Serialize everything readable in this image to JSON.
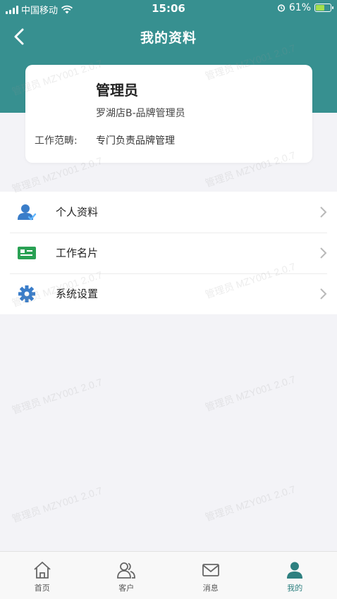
{
  "status_bar": {
    "carrier": "中国移动",
    "time": "15:06",
    "battery_text": "61%",
    "battery_level": 0.61
  },
  "nav": {
    "title": "我的资料"
  },
  "profile": {
    "name": "管理员",
    "role": "罗湖店B-品牌管理员",
    "scope_label": "工作范畴:",
    "scope_value": "专门负责品牌管理"
  },
  "menu": {
    "items": [
      {
        "label": "个人资料",
        "icon": "person-icon"
      },
      {
        "label": "工作名片",
        "icon": "business-card-icon"
      },
      {
        "label": "系统设置",
        "icon": "gear-icon"
      }
    ]
  },
  "watermark": {
    "text": "管理员 MZY001 2.0.7"
  },
  "tabs": [
    {
      "label": "首页",
      "icon": "home-icon",
      "active": false
    },
    {
      "label": "客户",
      "icon": "customers-icon",
      "active": false
    },
    {
      "label": "消息",
      "icon": "mail-icon",
      "active": false
    },
    {
      "label": "我的",
      "icon": "profile-icon",
      "active": true
    }
  ],
  "colors": {
    "header": "#379090",
    "accent": "#2e8080",
    "person_icon": "#3a7dc9",
    "card_icon": "#2aa154",
    "gear_icon": "#3a7dc9"
  }
}
